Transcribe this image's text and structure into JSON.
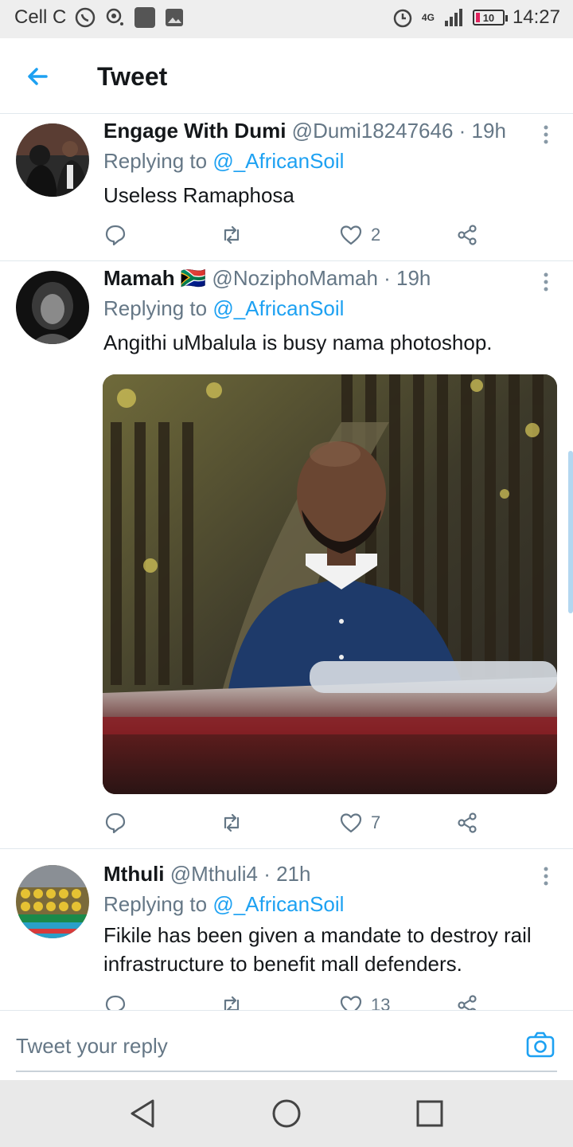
{
  "status_bar": {
    "carrier": "Cell C",
    "network": "4G",
    "battery": "10",
    "time": "14:27"
  },
  "header": {
    "title": "Tweet"
  },
  "tweets": [
    {
      "name": "Engage With Dumi",
      "handle": "@Dumi18247646 · 19h",
      "replying_prefix": "Replying to ",
      "replying_to": "@_AfricanSoil",
      "text": "Useless Ramaphosa",
      "likes": "2"
    },
    {
      "name": "Mamah",
      "name_flag": "🇿🇦",
      "handle": "@NoziphoMamah · 19h",
      "replying_prefix": "Replying to ",
      "replying_to": "@_AfricanSoil",
      "text": "Angithi uMbalula is busy nama photoshop.",
      "likes": "7"
    },
    {
      "name": "Mthuli",
      "handle": "@Mthuli4 · 21h",
      "replying_prefix": "Replying to ",
      "replying_to": "@_AfricanSoil",
      "text": "Fikile has been given a mandate to destroy rail infrastructure to benefit mall  defenders.",
      "likes": "13"
    }
  ],
  "reply_bar": {
    "placeholder": "Tweet your reply"
  },
  "colors": {
    "accent": "#1da1f2",
    "secondary_text": "#657786",
    "divider": "#e1e8ed"
  }
}
